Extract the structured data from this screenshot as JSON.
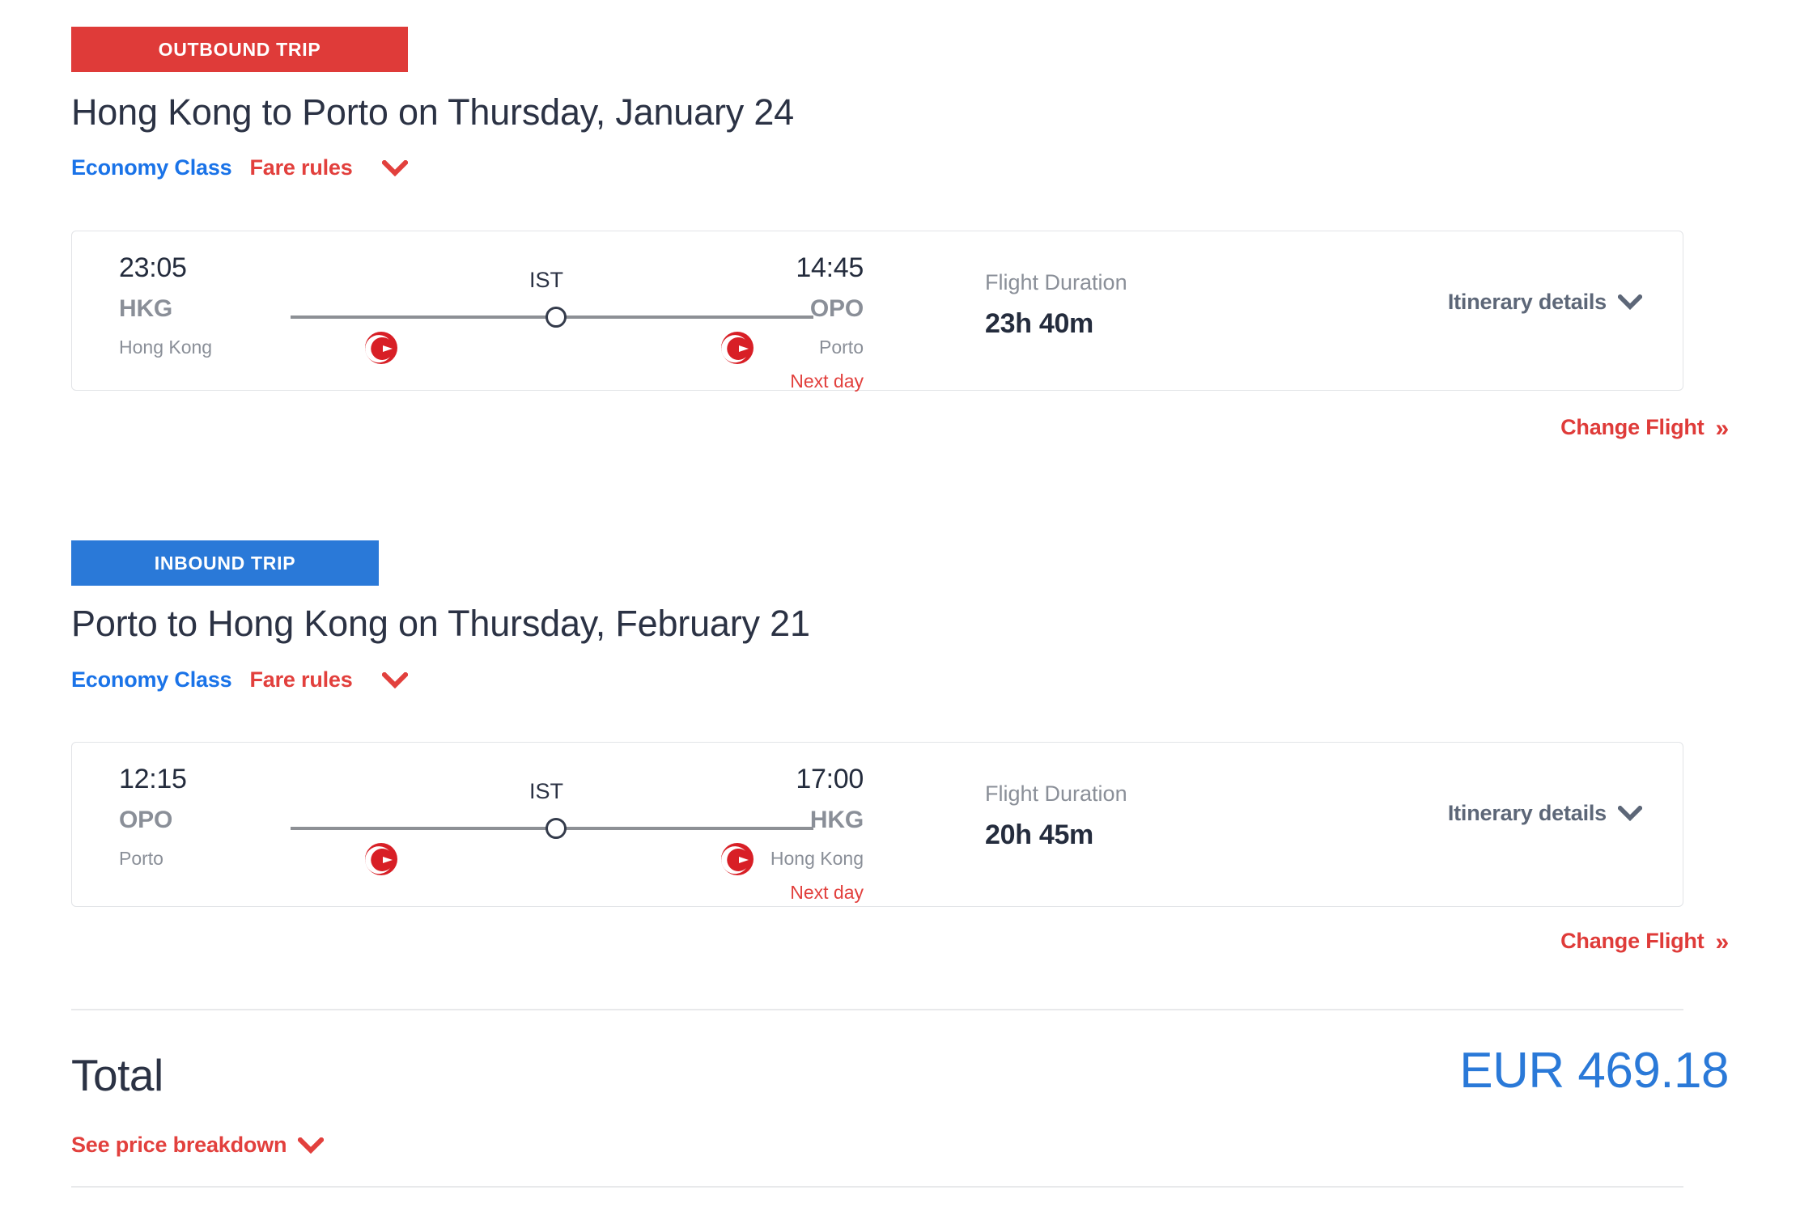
{
  "outbound": {
    "badge_label": "OUTBOUND TRIP",
    "badge_color": "#df3b39",
    "heading": "Hong Kong to Porto on Thursday, January 24",
    "cabin_class": "Economy Class",
    "fare_rules_label": "Fare rules",
    "flight": {
      "departure_time": "23:05",
      "departure_code": "HKG",
      "departure_city": "Hong Kong",
      "arrival_time": "14:45",
      "arrival_code": "OPO",
      "arrival_city": "Porto",
      "arrival_note": "Next day",
      "stop_code": "IST",
      "duration_label": "Flight Duration",
      "duration_value": "23h 40m",
      "itinerary_details_label": "Itinerary details",
      "airline_logo": "turkish-airlines-logo"
    },
    "change_flight_label": "Change Flight"
  },
  "inbound": {
    "badge_label": "INBOUND TRIP",
    "badge_color": "#2a79d8",
    "heading": "Porto to Hong Kong on Thursday, February 21",
    "cabin_class": "Economy Class",
    "fare_rules_label": "Fare rules",
    "flight": {
      "departure_time": "12:15",
      "departure_code": "OPO",
      "departure_city": "Porto",
      "arrival_time": "17:00",
      "arrival_code": "HKG",
      "arrival_city": "Hong Kong",
      "arrival_note": "Next day",
      "stop_code": "IST",
      "duration_label": "Flight Duration",
      "duration_value": "20h 45m",
      "itinerary_details_label": "Itinerary details",
      "airline_logo": "turkish-airlines-logo"
    },
    "change_flight_label": "Change Flight"
  },
  "totals": {
    "total_label": "Total",
    "price_breakdown_label": "See price breakdown",
    "currency": "EUR",
    "amount": "469.18",
    "total_display": "EUR 469.18"
  },
  "icons": {
    "chevron_down": "chevron-down-icon",
    "double_chevron_right": "»"
  },
  "colors": {
    "red": "#df3b39",
    "blue": "#2a79d8",
    "link_blue": "#1a73e8",
    "slate": "#5d6778",
    "gray": "#8a8f98",
    "dark": "#2b3244"
  }
}
